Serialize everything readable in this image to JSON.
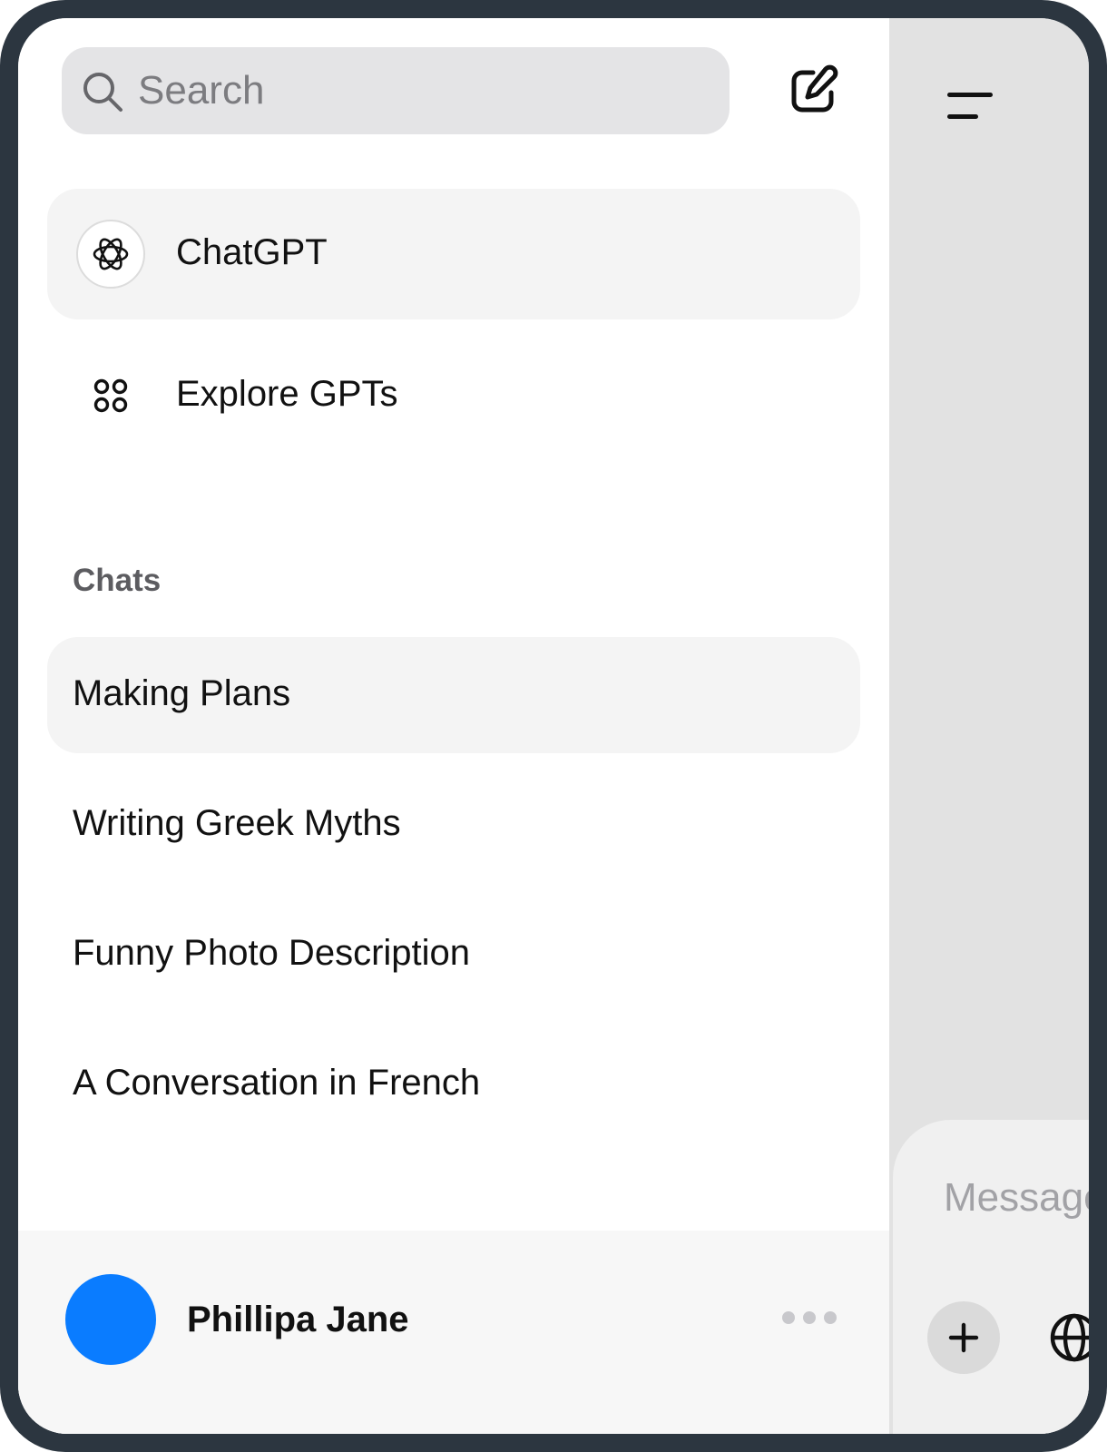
{
  "sidebar": {
    "search": {
      "placeholder": "Search",
      "value": ""
    },
    "compose_icon": "compose-icon",
    "nav": [
      {
        "label": "ChatGPT",
        "icon": "chatgpt-logo-icon",
        "active": true
      },
      {
        "label": "Explore GPTs",
        "icon": "grid-icon",
        "active": false
      }
    ],
    "chats_heading": "Chats",
    "chats": [
      {
        "title": "Making Plans",
        "active": true
      },
      {
        "title": "Writing Greek Myths",
        "active": false
      },
      {
        "title": "Funny Photo Description",
        "active": false
      },
      {
        "title": "A Conversation in French",
        "active": false
      }
    ],
    "user": {
      "name": "Phillipa Jane",
      "avatar_color": "#0a7cff",
      "more_icon": "more-horizontal-icon"
    }
  },
  "main": {
    "menu_icon": "menu-icon",
    "composer": {
      "placeholder": "Message",
      "plus_icon": "plus-icon",
      "globe_icon": "globe-icon"
    }
  },
  "colors": {
    "frame": "#2c3640",
    "search_bg": "#e4e4e6",
    "active_bg": "#f4f4f4",
    "overlay": "#e2e2e2",
    "accent": "#0a7cff"
  }
}
